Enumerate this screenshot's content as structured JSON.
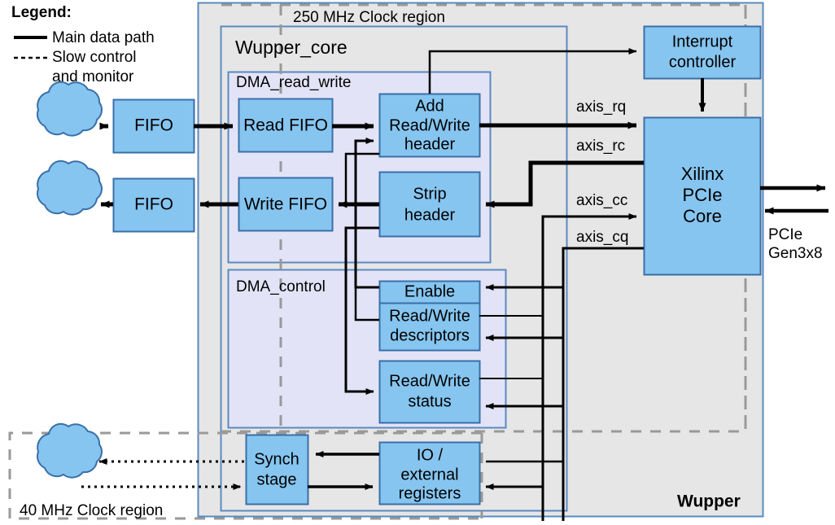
{
  "legend": {
    "title": "Legend:",
    "items": [
      {
        "style": "solid",
        "label": "Main data path"
      },
      {
        "style": "dotted",
        "label_line1": "Slow control",
        "label_line2": "and monitor"
      }
    ]
  },
  "regions": {
    "clock_250": "250 MHz Clock region",
    "clock_40": "40 MHz Clock region",
    "wupper": "Wupper",
    "wupper_core": "Wupper_core",
    "dma_read_write": "DMA_read_write",
    "dma_control": "DMA_control"
  },
  "blocks": {
    "fifo_in": "FIFO",
    "fifo_out": "FIFO",
    "read_fifo": "Read FIFO",
    "write_fifo": "Write FIFO",
    "add_header_l1": "Add",
    "add_header_l2": "Read/Write",
    "add_header_l3": "header",
    "strip_header_l1": "Strip",
    "strip_header_l2": "header",
    "enable": "Enable",
    "descriptors_l1": "Read/Write",
    "descriptors_l2": "descriptors",
    "status_l1": "Read/Write",
    "status_l2": "status",
    "interrupt_l1": "Interrupt",
    "interrupt_l2": "controller",
    "pcie_core_l1": "Xilinx",
    "pcie_core_l2": "PCIe",
    "pcie_core_l3": "Core",
    "synch_l1": "Synch",
    "synch_l2": "stage",
    "io_regs_l1": "IO /",
    "io_regs_l2": "external",
    "io_regs_l3": "registers"
  },
  "signals": {
    "axis_rq": "axis_rq",
    "axis_rc": "axis_rc",
    "axis_cc": "axis_cc",
    "axis_cq": "axis_cq",
    "pcie_l1": "PCIe",
    "pcie_l2": "Gen3x8"
  },
  "colors": {
    "block_fill": "#86c5f0",
    "block_stroke": "#3a6fa8",
    "wupper_fill": "#e6e6e6",
    "core_fill": "#e6e6e6",
    "dma_fill": "#e3e3f7",
    "dashed_region": "#999999",
    "line": "#000000"
  }
}
